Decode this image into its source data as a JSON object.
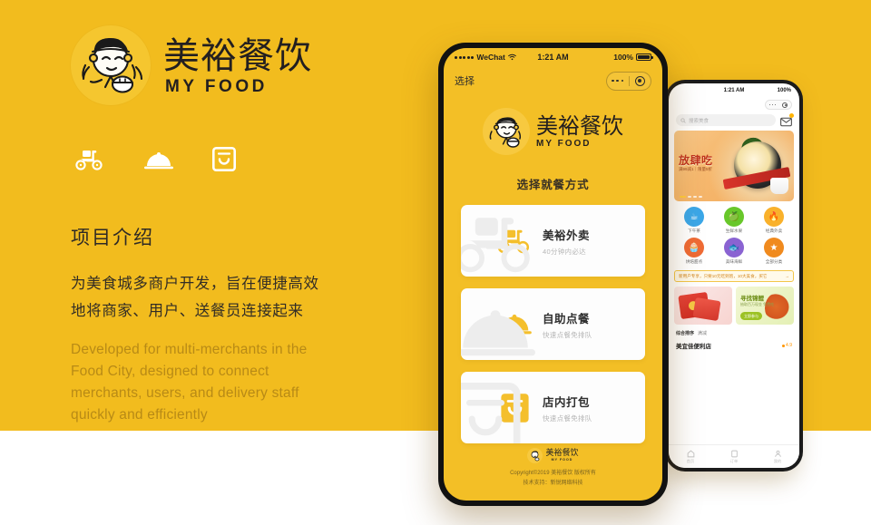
{
  "theme": {
    "background": "#f2bc1e",
    "accent": "#f4bf2c",
    "card_bg": "#fdfdfd",
    "text_dark": "#2f2f2f"
  },
  "brand": {
    "name_cn": "美裕餐饮",
    "name_en": "MY FOOD"
  },
  "left": {
    "features": [
      {
        "icon": "scooter-icon",
        "label": "delivery"
      },
      {
        "icon": "cloche-icon",
        "label": "dine-in"
      },
      {
        "icon": "takeout-bag-icon",
        "label": "takeout"
      }
    ],
    "section_title": "项目介绍",
    "desc_cn": "为美食城多商户开发，旨在便捷高效地将商家、用户、送餐员连接起来",
    "desc_en": "Developed for multi-merchants in the Food City, designed to connect merchants, users, and delivery staff quickly and efficiently"
  },
  "phone_front": {
    "status_bar": {
      "carrier": "WeChat",
      "signal_icon": "signal-dots-icon",
      "wifi_icon": "wifi-icon",
      "time": "1:21 AM",
      "battery_text": "100%",
      "battery_icon": "battery-full-icon"
    },
    "nav": {
      "title": "选择",
      "capsule_more_icon": "more-dots-icon",
      "capsule_target_icon": "target-circle-icon"
    },
    "heading": "选择就餐方式",
    "options": [
      {
        "icon": "scooter-icon",
        "title": "美裕外卖",
        "subtitle": "40分钟内必达"
      },
      {
        "icon": "cloche-icon",
        "title": "自助点餐",
        "subtitle": "快速点餐免排队"
      },
      {
        "icon": "takeout-bag-icon",
        "title": "店内打包",
        "subtitle": "快速点餐免排队"
      }
    ],
    "footer": {
      "copyright": "Copyright©2019 美裕餐饮 版权所有",
      "tech": "技术支持：新锐网络科技"
    }
  },
  "phone_back": {
    "status_bar": {
      "time": "1:21 AM",
      "battery_text": "100%"
    },
    "search": {
      "placeholder": "搜索美食",
      "search_icon": "search-icon",
      "mail_icon": "mail-icon"
    },
    "banner": {
      "title": "放肆吃",
      "subtitle": "满99减1｜限量5折"
    },
    "categories": [
      {
        "label": "下午茶",
        "color": "#3ba7e8",
        "glyph": "☕"
      },
      {
        "label": "生鲜水果",
        "color": "#68c72a",
        "glyph": "🍎"
      },
      {
        "label": "经典外卖",
        "color": "#f9b12b",
        "glyph": "🔥"
      },
      {
        "label": "烘焙甜点",
        "color": "#ef6b35",
        "glyph": "🧁"
      },
      {
        "label": "美味海鲜",
        "color": "#8a63d2",
        "glyph": "🐟"
      },
      {
        "label": "全部分类",
        "color": "#f08a1e",
        "glyph": "★"
      }
    ],
    "promo": {
      "text": "新用户专享，只要10元吃到饱，10大美食，买它",
      "arrow": "→"
    },
    "promo_cards": [
      {
        "type": "red-envelope",
        "title": "",
        "subtitle": "",
        "button": ""
      },
      {
        "type": "koi",
        "title": "寻找锦鲤",
        "subtitle": "抽取百万现金\n免费吃",
        "button": "立即参与"
      }
    ],
    "filters": [
      "综合排序",
      "满减"
    ],
    "store": {
      "name": "美宜佳便利店",
      "rating": "4.9"
    },
    "tabs": [
      {
        "label": "首页",
        "icon": "home-icon"
      },
      {
        "label": "订单",
        "icon": "orders-icon"
      },
      {
        "label": "我的",
        "icon": "profile-icon"
      }
    ]
  }
}
